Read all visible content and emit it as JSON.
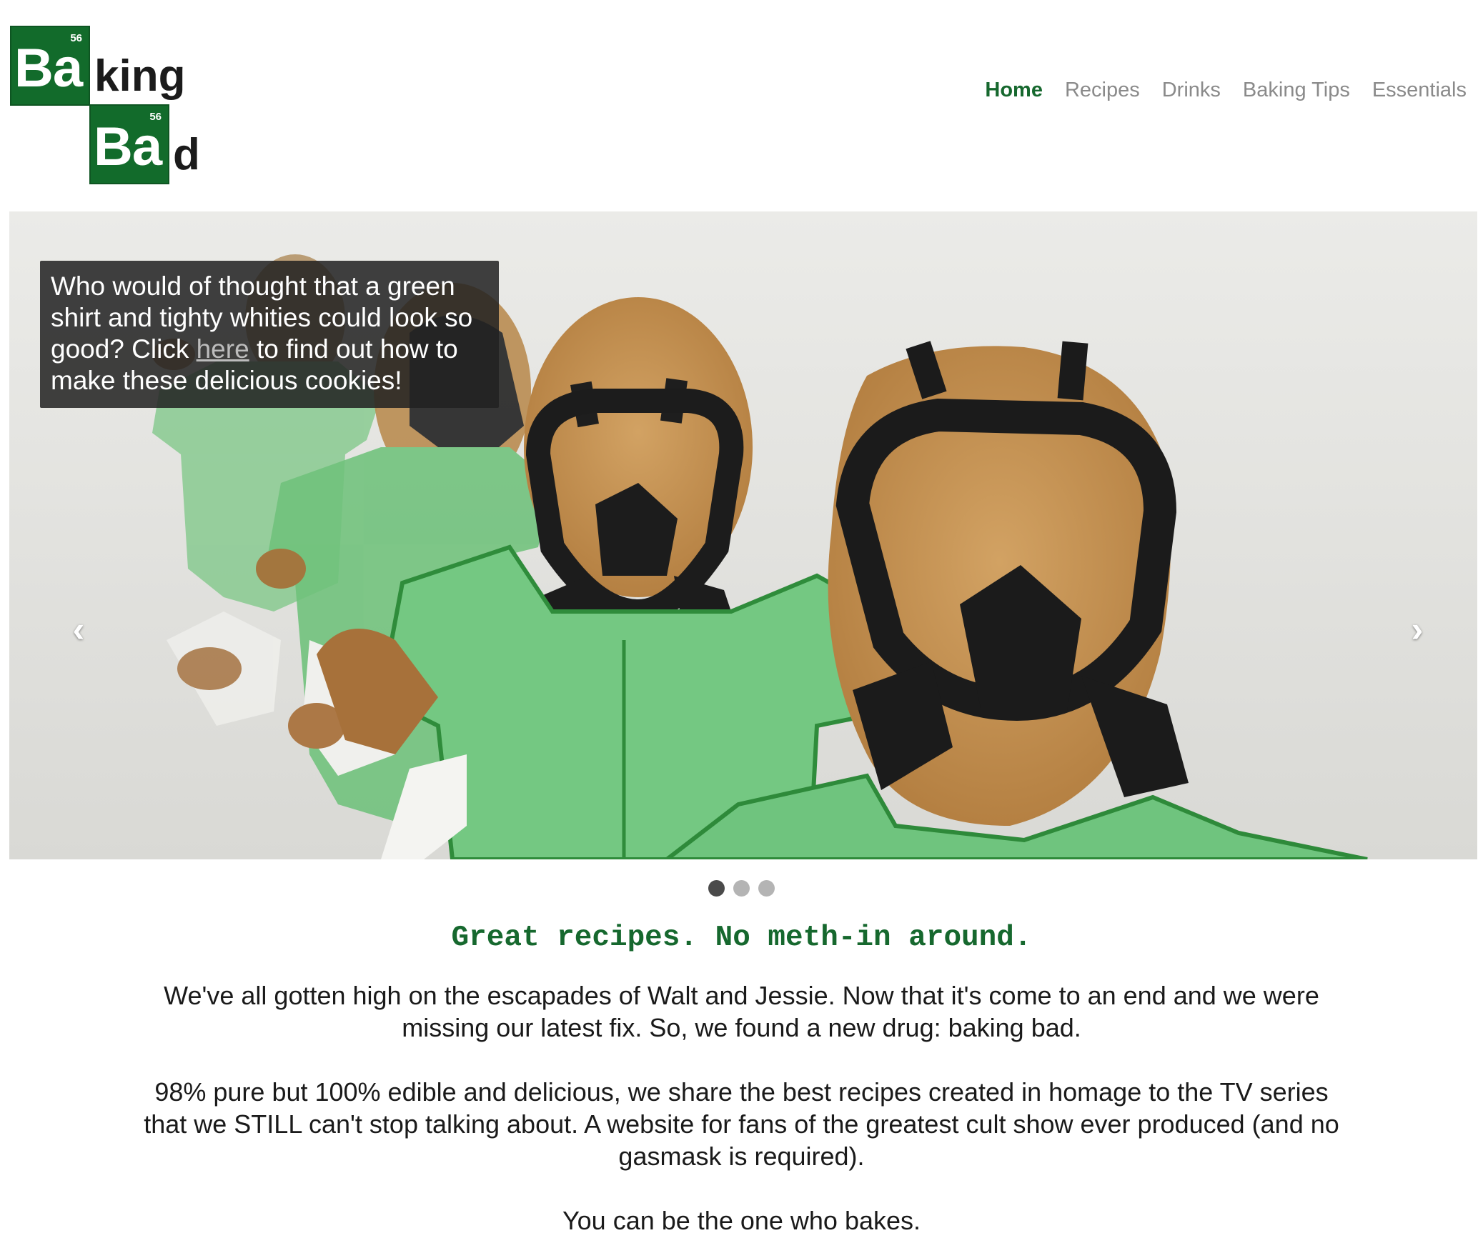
{
  "logo": {
    "line1": {
      "number": "56",
      "symbol": "Ba",
      "rest": "king"
    },
    "line2": {
      "number": "56",
      "symbol": "Ba",
      "rest": "d"
    }
  },
  "nav": {
    "items": [
      {
        "label": "Home",
        "active": true
      },
      {
        "label": "Recipes",
        "active": false
      },
      {
        "label": "Drinks",
        "active": false
      },
      {
        "label": "Baking Tips",
        "active": false
      },
      {
        "label": "Essentials",
        "active": false
      }
    ]
  },
  "hero": {
    "image_subject": "green-shirt gas mask cookies",
    "caption": {
      "before_link": "Who would of thought that a green shirt and tighty whities could look so good? Click ",
      "link_text": "here",
      "after_link": " to find out how to make these delicious cookies!"
    },
    "prev_icon": "‹",
    "next_icon": "›",
    "slide_count": 3,
    "active_slide": 1
  },
  "main": {
    "tagline": "Great recipes. No meth-in around.",
    "paragraph1": "We've all gotten high on the escapades of Walt and Jessie. Now that it's come to an end and we were missing our latest fix. So, we found a new drug: baking bad.",
    "paragraph2": "98% pure but 100% edible and delicious, we share the best recipes created in homage to the TV series that we STILL can't stop talking about. A website for fans of the greatest cult show ever produced (and no gasmask is required).",
    "paragraph3": "You can be the one who bakes."
  },
  "colors": {
    "brand_green": "#16682e",
    "tile_green": "#126b2b",
    "nav_inactive": "#8a8a8a",
    "cookie_icing_green": "#6cc77a",
    "mask_black": "#1c1c1c"
  }
}
